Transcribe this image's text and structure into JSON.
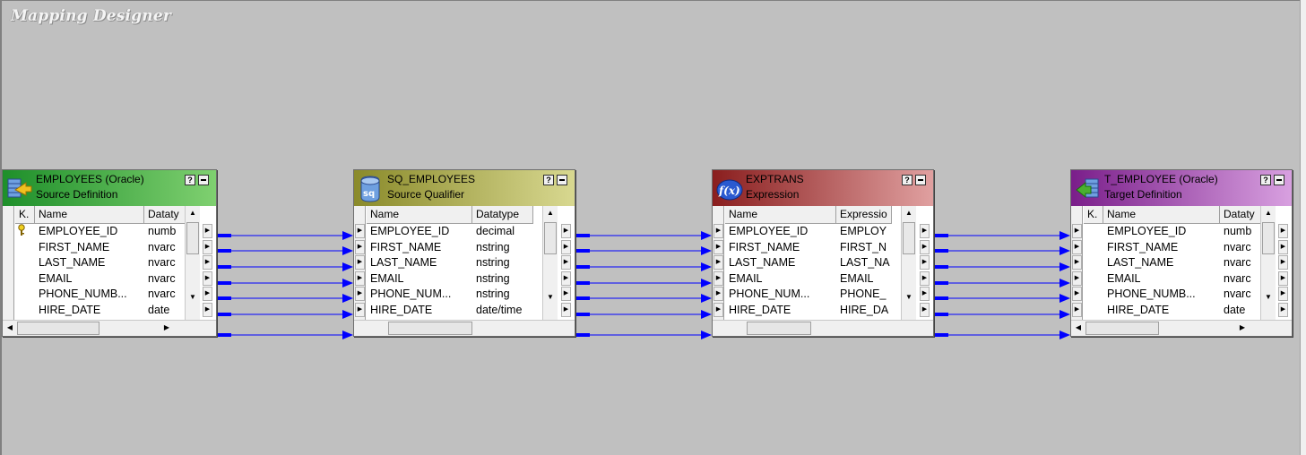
{
  "canvas": {
    "title": "Mapping Designer"
  },
  "transformations": [
    {
      "name": "EMPLOYEES (Oracle)",
      "subtitle": "Source Definition",
      "icon": "source-definition-icon",
      "header_gradient": [
        "#1e8f2a",
        "#7fd070"
      ],
      "columns": [
        "K.",
        "Name",
        "Dataty"
      ],
      "rows": [
        {
          "key": "key",
          "name": "EMPLOYEE_ID",
          "type": "numb"
        },
        {
          "key": "",
          "name": "FIRST_NAME",
          "type": "nvarc"
        },
        {
          "key": "",
          "name": "LAST_NAME",
          "type": "nvarc"
        },
        {
          "key": "",
          "name": "EMAIL",
          "type": "nvarc"
        },
        {
          "key": "",
          "name": "PHONE_NUMB...",
          "type": "nvarc"
        },
        {
          "key": "",
          "name": "HIRE_DATE",
          "type": "date"
        }
      ]
    },
    {
      "name": "SQ_EMPLOYEES",
      "subtitle": "Source Qualifier",
      "icon": "source-qualifier-icon",
      "header_gradient": [
        "#8a8a2a",
        "#d8d890"
      ],
      "columns": [
        "Name",
        "Datatype"
      ],
      "rows": [
        {
          "name": "EMPLOYEE_ID",
          "type": "decimal"
        },
        {
          "name": "FIRST_NAME",
          "type": "nstring"
        },
        {
          "name": "LAST_NAME",
          "type": "nstring"
        },
        {
          "name": "EMAIL",
          "type": "nstring"
        },
        {
          "name": "PHONE_NUM...",
          "type": "nstring"
        },
        {
          "name": "HIRE_DATE",
          "type": "date/time"
        }
      ]
    },
    {
      "name": "EXPTRANS",
      "subtitle": "Expression",
      "icon": "expression-icon",
      "header_gradient": [
        "#8a1e1e",
        "#e0a0a0"
      ],
      "columns": [
        "Name",
        "Expressio"
      ],
      "rows": [
        {
          "name": "EMPLOYEE_ID",
          "type": "EMPLOY"
        },
        {
          "name": "FIRST_NAME",
          "type": "FIRST_N"
        },
        {
          "name": "LAST_NAME",
          "type": "LAST_NA"
        },
        {
          "name": "EMAIL",
          "type": "EMAIL"
        },
        {
          "name": "PHONE_NUM...",
          "type": "PHONE_"
        },
        {
          "name": "HIRE_DATE",
          "type": "HIRE_DA"
        }
      ]
    },
    {
      "name": "T_EMPLOYEE (Oracle)",
      "subtitle": "Target Definition",
      "icon": "target-definition-icon",
      "header_gradient": [
        "#7a1e8a",
        "#d8a0e0"
      ],
      "columns": [
        "K.",
        "Name",
        "Dataty"
      ],
      "rows": [
        {
          "key": "",
          "name": "EMPLOYEE_ID",
          "type": "numb"
        },
        {
          "key": "",
          "name": "FIRST_NAME",
          "type": "nvarc"
        },
        {
          "key": "",
          "name": "LAST_NAME",
          "type": "nvarc"
        },
        {
          "key": "",
          "name": "EMAIL",
          "type": "nvarc"
        },
        {
          "key": "",
          "name": "PHONE_NUMB...",
          "type": "nvarc"
        },
        {
          "key": "",
          "name": "HIRE_DATE",
          "type": "date"
        }
      ]
    }
  ],
  "link_color": "#0000ff"
}
